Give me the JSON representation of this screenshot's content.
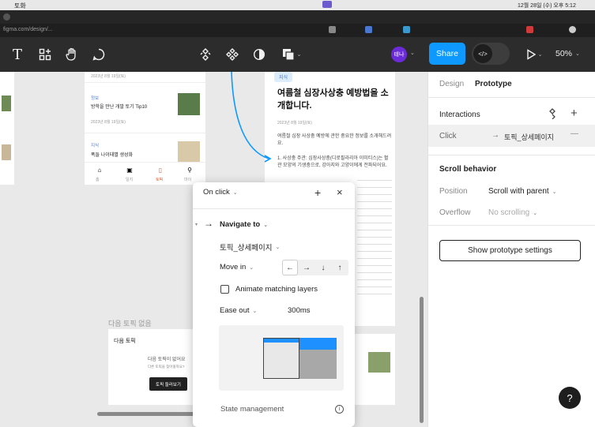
{
  "browser": {
    "menubar_left": "토화",
    "menubar_time": "12월 28일 (수) 오후 5:12",
    "url": "figma.com/design/..."
  },
  "toolbar": {
    "share_label": "Share",
    "avatar_initials": "테나",
    "zoom": "50%"
  },
  "canvas": {
    "left_list": [
      {
        "date": "2023년 8월 19일(토)",
        "tag": "",
        "title": ""
      },
      {
        "date": "2023년 8월 19일(토)",
        "tag": "정보",
        "title": "방학을 만난 개발 토기 Tip10"
      },
      {
        "date": "",
        "tag": "지식",
        "title": "폭들 나이태별 생성화"
      }
    ],
    "bottom_nav": [
      "홈",
      "일지",
      "토픽",
      "마이"
    ],
    "article": {
      "tag": "지식",
      "title": "여름철 심장사상충 예방법을 소개합니다.",
      "date": "2023년 8월 19일(토)",
      "intro": "여름철 심장 사상충 예방에 관한 중요한 정보를 소개해드려요.",
      "item1": "1. 사상충 주관: 심장사상충(디로필라리아 이미티스)는 혈관 모양의 기생충으로, 강아지와 고양이에게 전파되어요."
    },
    "empty_section_label": "다음 토픽 없음",
    "empty_card": {
      "title": "다음 토픽",
      "line1": "다음 토픽이 없어요",
      "line2": "다른 토픽을 찾아볼까요?",
      "button": "토픽 둘러보기"
    }
  },
  "popup": {
    "trigger": "On click",
    "action": "Navigate to",
    "destination": "토픽_상세페이지",
    "animation": "Move in",
    "directions": [
      "←",
      "→",
      "↓",
      "↑"
    ],
    "animate_label": "Animate matching layers",
    "easing": "Ease out",
    "duration": "300ms",
    "state_label": "State management"
  },
  "panel": {
    "tab_design": "Design",
    "tab_prototype": "Prototype",
    "interactions_label": "Interactions",
    "interaction_trigger": "Click",
    "interaction_target": "토픽_상세페이지",
    "scroll_label": "Scroll behavior",
    "position_label": "Position",
    "position_value": "Scroll with parent",
    "overflow_label": "Overflow",
    "overflow_value": "No scrolling",
    "settings_button": "Show prototype settings",
    "help": "?"
  }
}
